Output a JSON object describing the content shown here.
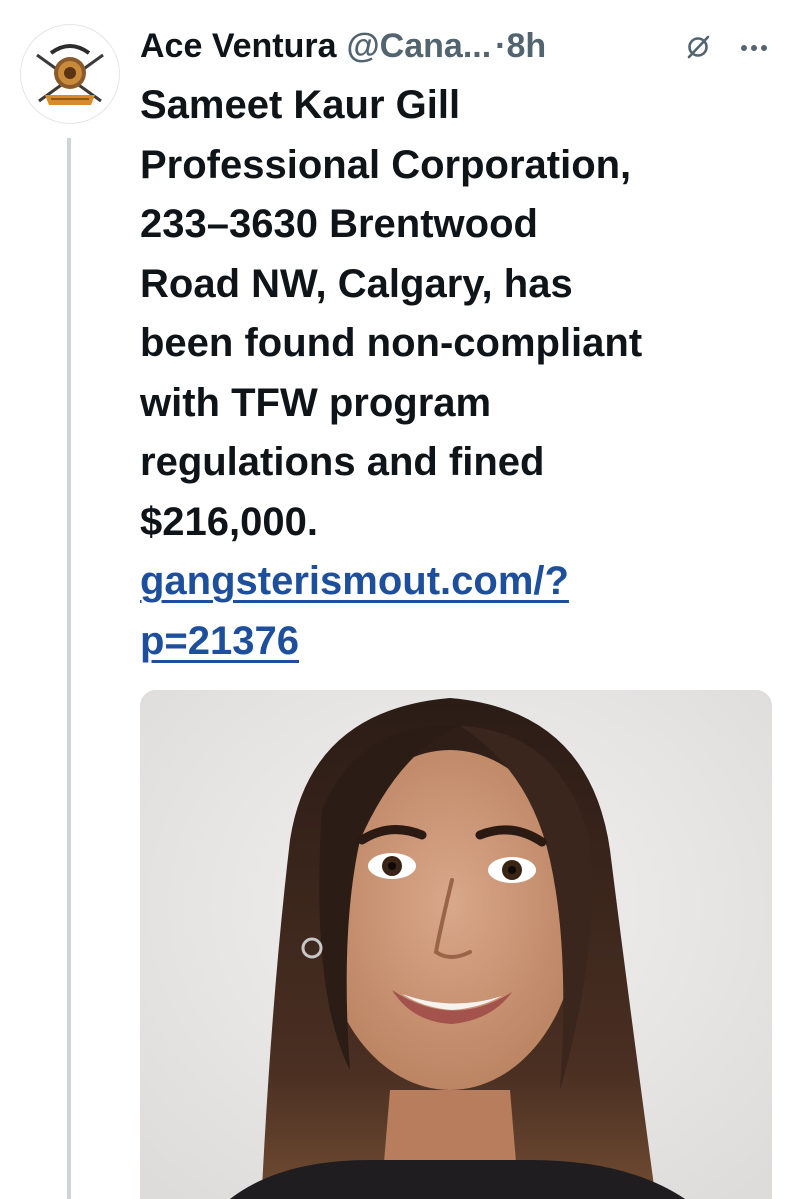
{
  "author": {
    "name": "Ace Ventura",
    "handle": "@Cana...",
    "separator": "·",
    "time": "8h"
  },
  "icons": {
    "avatar": "emblem-avatar",
    "grok": "grok-icon",
    "more": "more-icon"
  },
  "tweet": {
    "text_lines": [
      "Sameet Kaur Gill",
      "Professional Corporation,",
      "233–3630 Brentwood",
      "Road NW, Calgary, has",
      "been found non-compliant",
      "with TFW program",
      "regulations and fined",
      "$216,000."
    ],
    "link_lines": [
      "gangsterismout.com/?",
      "p=21376"
    ]
  },
  "media": {
    "type": "photo",
    "subject": "portrait-photo"
  },
  "colors": {
    "text": "#0f1419",
    "muted": "#536471",
    "link": "#1d4f9c",
    "thread_line": "#cfd4d9"
  }
}
